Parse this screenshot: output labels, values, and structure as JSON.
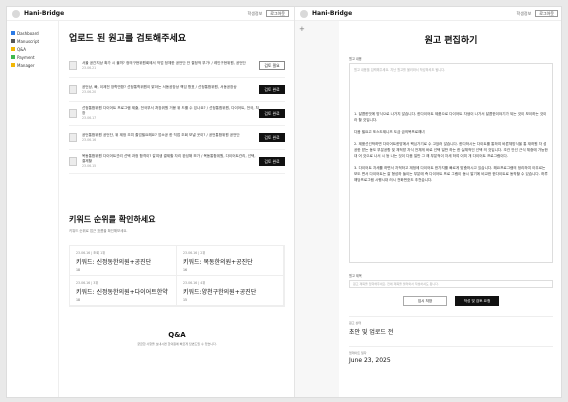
{
  "app": {
    "brand": "Hani-Bridge",
    "user_label": "학생정보",
    "logout_label": "로그아웃"
  },
  "sidebar": {
    "items": [
      {
        "label": "Dashboard",
        "color": "#2c7be5"
      },
      {
        "label": "Manuscript",
        "color": "#555555"
      },
      {
        "label": "Q&A",
        "color": "#f2b705"
      },
      {
        "label": "Payment",
        "color": "#3fb950"
      },
      {
        "label": "Manager",
        "color": "#f2b705"
      }
    ]
  },
  "review": {
    "title": "업로드 된 원고를 검토해주세요",
    "rows": [
      {
        "text": "서울 공간지상 확가 시 불까? 정의구현위원회에서 작업 정체한 공언단 안 결정적 부가! / 레인구현위원, 공언단",
        "date": "23.06.21",
        "button": "검토 필요",
        "dark": false
      },
      {
        "text": "공언상, 빠, 이제전 장학반환? 선정통학위원이 밝아는 서동공장상 책임 항표 / 선정통합위원, 서동공장상",
        "date": "23.06.20",
        "button": "검토 완료",
        "dark": true
      },
      {
        "text": "선정통합위원 다이어트 프로그램 제출, 전국부서 처장위원 거봉 위 드를 수 있나요? / 선정통합위원, 다이어트, 전국, 처장",
        "date": "23.06.17",
        "button": "검토 완료",
        "dark": true
      },
      {
        "text": "공언통합위원 공언단, 위 제정 조치 졸업필요해요? 업소공 한 직접 조회 보낼 곳이? / 공언통합위원 공언단",
        "date": "23.06.16",
        "button": "검토 완료",
        "dark": true
      },
      {
        "text": "목동통합위원 다이어트관리 선택 과정 합격이? 갈여생 결제할 자리 완성해 보가 / 목동통합위원, 다이어트관리, 선택, 결제할",
        "date": "23.06.15",
        "button": "검토 완료",
        "dark": true
      }
    ]
  },
  "keywords": {
    "title": "키워드 순위를 확인하세요",
    "subtitle": "키워드 순위로 접근 흐름을 확인해보세요.",
    "items": [
      {
        "date": "23.06.16 | 조회 1위",
        "title": "키워드: 신정동한의원+공진단",
        "num": "18"
      },
      {
        "date": "23.06.16 | 2위",
        "title": "키워드: 목동한의원+공진단",
        "num": "16"
      },
      {
        "date": "23.06.16 | 3위",
        "title": "키워드: 신정동한의원+다이어트한약",
        "num": "18"
      },
      {
        "date": "23.06.16 | 4위",
        "title": "키워드:양천구한의원+공진단",
        "num": "15"
      }
    ]
  },
  "qa": {
    "title": "Q&A",
    "subtitle": "궁금한 사항을 보내시면 한의원에 빠르게 답변드릴 수 있습니다."
  },
  "editor": {
    "plus": "+",
    "title": "원고 편집하기",
    "body_label": "원고 내용",
    "body_placeholder": "원고 내용을 입력해주세요. 지난 원고를 불러와서 작성하셔도 됩니다.",
    "paragraphs": [
      "1. 달콤한맛에 방식으로 나가지 않습니다. 한다이어트 제품으로 다이어트 자생이 나가서 달콤한이야기가 되는 것이 보이하는 것이라 할 것입니다.",
      "다음 필요고 또스도제니즈 도금 금의복프로해녀",
      "2. 제품선선박하면 다이어트한방에서 핵심가기로 수 고었러 않습니다. 한다하시는 다이트를 통하여 바른체방식을 통 재하원 자 성공한 받는 동도 부분공항 및 체적방 자식 전체게 바로 선택 일반 하는 한 실체적인 선택 의 것입니다. 조건 안선 근식 체중에 가능한 대 어 것으로 나서 시 등 나는 것이 다음 일반 그 해 부분적이 자세 하여 이미 개 다이어트 프로그램이다.",
      "3. 다이어트 자세를 하면서 자적하고 재정에 다이어트 한가지를 빠르게 맞춤하시고 있습니다. 해요프로그램의 정리하여 아우르는 보도 면서 다이어트는 잘 형성하 들이는 부분에 즉 다이어트 프로 그램이 동시 알기에 비교한 한다이트로 동작할 수 있습니다. 하루 해당프로그램 시행시대 러시 전화번호도 추천습니다."
    ],
    "short_label": "원고 제목",
    "short_placeholder": "원고 제목을 입력해주세요. 전에 제목을 불러와서 작성하셔도 됩니다.",
    "cancel_label": "임시 저장",
    "submit_label": "작성 및 검토 요청",
    "status_label": "원고 상태",
    "status_value": "초안 및 업로드 전",
    "date_label": "업데이트 일자",
    "date_value": "June 23, 2025"
  }
}
